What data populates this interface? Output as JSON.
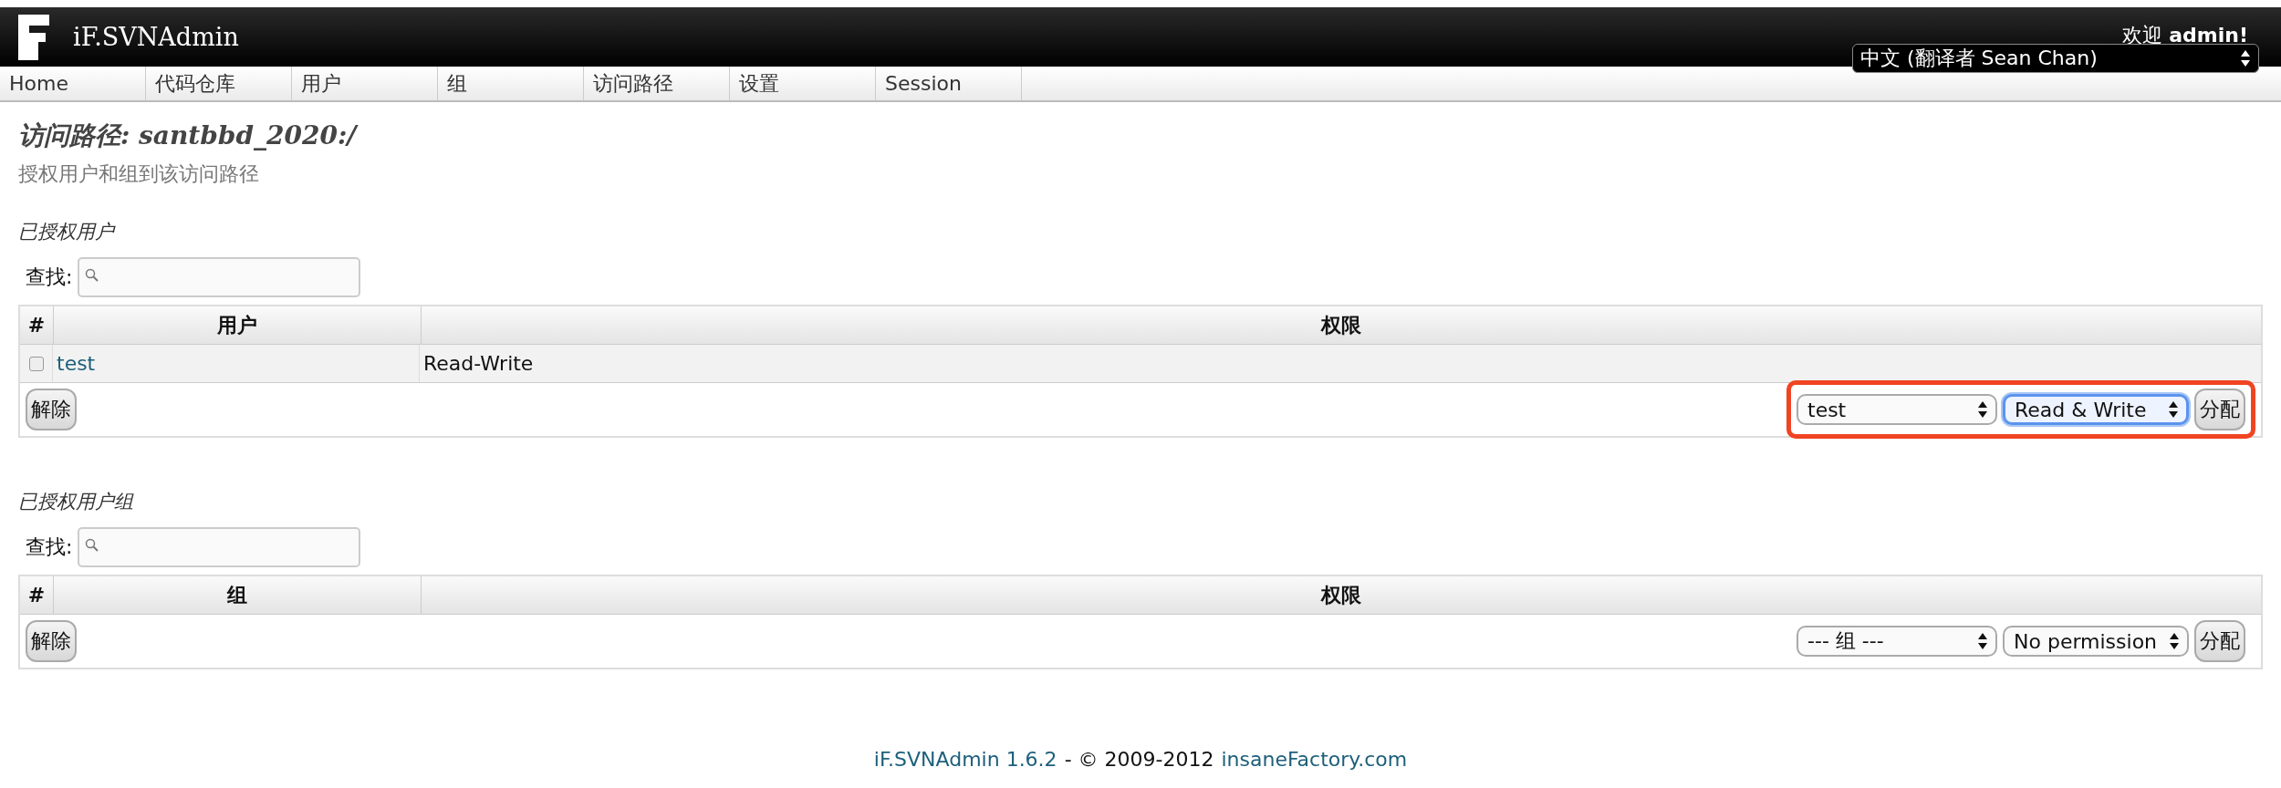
{
  "header": {
    "app_name": "iF.SVNAdmin",
    "welcome": "欢迎 **admin!**",
    "language_select": {
      "value": "中文 (翻译者 Sean Chan)"
    }
  },
  "nav": [
    {
      "label": "Home"
    },
    {
      "label": "代码仓库"
    },
    {
      "label": "用户"
    },
    {
      "label": "组"
    },
    {
      "label": "访问路径"
    },
    {
      "label": "设置"
    },
    {
      "label": "Session"
    }
  ],
  "page": {
    "title": "访问路径: santbbd_2020:/",
    "subtitle": "授权用户和组到该访问路径"
  },
  "sections": [
    {
      "heading": "已授权用户",
      "search_label": "查找:",
      "columns": [
        "#",
        "用户",
        "权限"
      ],
      "rows": [
        {
          "checked": false,
          "name": "test",
          "permission": "Read-Write"
        }
      ],
      "remove_button": "解除",
      "highlighted": true,
      "name_select": {
        "value": "test",
        "focused": false
      },
      "permission_select": {
        "value": "Read & Write",
        "focused": true
      },
      "assign_button": "分配"
    },
    {
      "heading": "已授权用户组",
      "search_label": "查找:",
      "columns": [
        "#",
        "组",
        "权限"
      ],
      "remove_button": "解除",
      "highlighted": false,
      "name_select": {
        "value": "--- 组 ---",
        "focused": false
      },
      "permission_select": {
        "value": "No permission",
        "focused": false
      },
      "assign_button": "分配"
    }
  ],
  "footer": {
    "version_link": "iF.SVNAdmin 1.6.2",
    "copyright": "- © 2009-2012",
    "site_link": "insaneFactory.com"
  }
}
